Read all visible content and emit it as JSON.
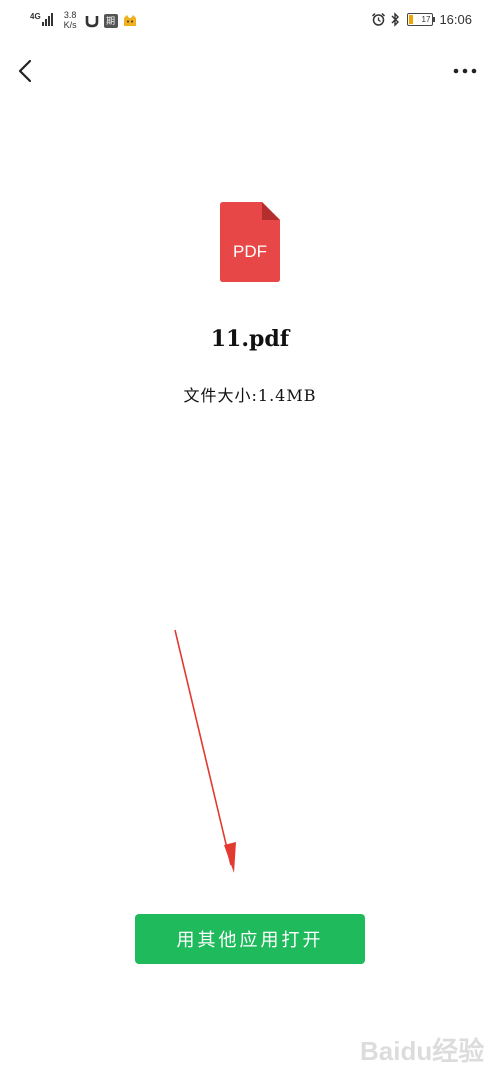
{
  "status_bar": {
    "network_type": "4G",
    "speed_value": "3.8",
    "speed_unit": "K/s",
    "calendar_badge": "期",
    "battery_level": "17",
    "time": "16:06"
  },
  "nav": {
    "back_icon": "chevron-left-icon",
    "more_icon": "more-horizontal-icon"
  },
  "file": {
    "icon_label": "PDF",
    "icon_color": "#e84747",
    "name": "11.pdf",
    "size_text": "文件大小:1.4MB"
  },
  "actions": {
    "open_with_label": "用其他应用打开",
    "button_color": "#1fba5c"
  },
  "annotation": {
    "arrow_color": "#e23a2f"
  },
  "watermark": {
    "text": "Baidu经验"
  }
}
